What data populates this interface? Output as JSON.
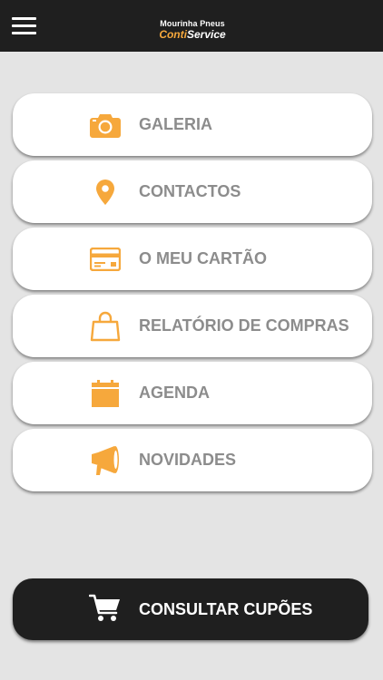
{
  "header": {
    "menu_icon": "hamburger-icon",
    "logo_top": "Mourinha Pneus",
    "logo_conti": "Conti",
    "logo_service": "Service"
  },
  "menu": [
    {
      "label": "GALERIA",
      "icon": "camera-icon"
    },
    {
      "label": "CONTACTOS",
      "icon": "map-pin-icon"
    },
    {
      "label": "O MEU CARTÃO",
      "icon": "credit-card-icon"
    },
    {
      "label": "RELATÓRIO DE COMPRAS",
      "icon": "shopping-bag-icon"
    },
    {
      "label": "AGENDA",
      "icon": "calendar-icon"
    },
    {
      "label": "NOVIDADES",
      "icon": "megaphone-icon"
    }
  ],
  "cta": {
    "label": "CONSULTAR CUPÕES",
    "icon": "cart-icon"
  },
  "colors": {
    "accent": "#f6a83c",
    "header": "#1f1f1f",
    "background": "#e4e4e4",
    "label": "#8c8c8c"
  }
}
